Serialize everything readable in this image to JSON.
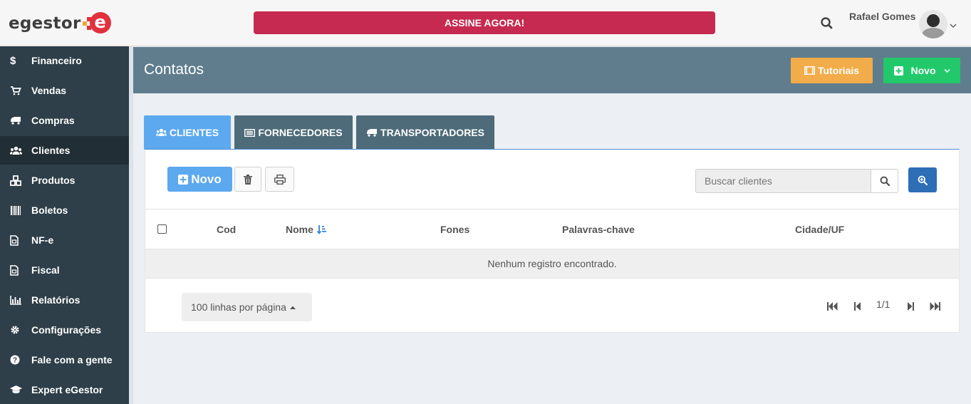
{
  "header": {
    "logo_text": "egestor",
    "logo_mark": "e",
    "cta_label": "ASSINE AGORA!",
    "user_name": "Rafael Gomes",
    "colors": {
      "cta": "#c62a51",
      "logo_red": "#e0313d"
    }
  },
  "sidebar": {
    "items": [
      {
        "label": "Financeiro",
        "icon": "dollar-icon"
      },
      {
        "label": "Vendas",
        "icon": "cart-icon"
      },
      {
        "label": "Compras",
        "icon": "truck-icon"
      },
      {
        "label": "Clientes",
        "icon": "users-icon",
        "active": true
      },
      {
        "label": "Produtos",
        "icon": "cubes-icon"
      },
      {
        "label": "Boletos",
        "icon": "barcode-icon"
      },
      {
        "label": "NF-e",
        "icon": "file-icon"
      },
      {
        "label": "Fiscal",
        "icon": "file-icon"
      },
      {
        "label": "Relatórios",
        "icon": "bar-chart-icon"
      },
      {
        "label": "Configurações",
        "icon": "gear-icon"
      },
      {
        "label": "Fale com a gente",
        "icon": "question-icon"
      },
      {
        "label": "Expert eGestor",
        "icon": "graduation-cap-icon"
      }
    ]
  },
  "page": {
    "title": "Contatos",
    "tutorials_label": "Tutoriais",
    "new_label": "Novo"
  },
  "tabs": [
    {
      "label": "CLIENTES",
      "icon": "users-icon",
      "active": true
    },
    {
      "label": "FORNECEDORES",
      "icon": "list-icon",
      "active": false
    },
    {
      "label": "TRANSPORTADORES",
      "icon": "truck-icon",
      "active": false
    }
  ],
  "toolbar": {
    "new_label": "Novo",
    "search_placeholder": "Buscar clientes"
  },
  "table": {
    "columns": [
      "Cod",
      "Nome",
      "Fones",
      "Palavras-chave",
      "Cidade/UF"
    ],
    "sorted_column": "Nome",
    "empty_message": "Nenhum registro encontrado."
  },
  "pagination": {
    "per_page_label": "100 linhas por página",
    "page_label": "1/1"
  }
}
